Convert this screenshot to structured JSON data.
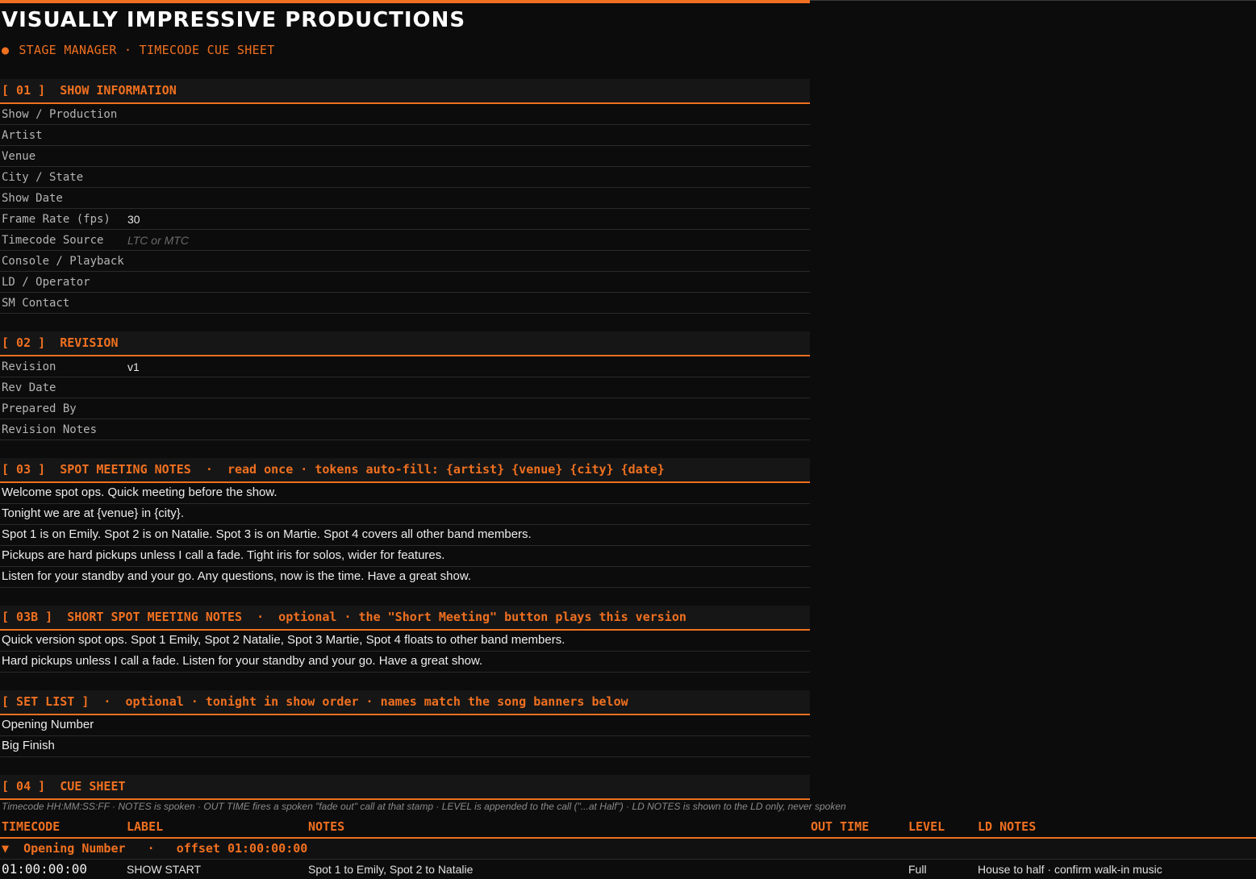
{
  "header": {
    "title": "VISUALLY IMPRESSIVE PRODUCTIONS",
    "subtitle_dot": "●",
    "subtitle": "STAGE MANAGER · TIMECODE CUE SHEET"
  },
  "show_info": {
    "header": "[ 01 ]  SHOW INFORMATION",
    "fields": [
      {
        "label": "Show / Production",
        "value": ""
      },
      {
        "label": "Artist",
        "value": ""
      },
      {
        "label": "Venue",
        "value": ""
      },
      {
        "label": "City / State",
        "value": ""
      },
      {
        "label": "Show Date",
        "value": ""
      },
      {
        "label": "Frame Rate (fps)",
        "value": "30"
      },
      {
        "label": "Timecode Source",
        "value": "",
        "placeholder": "LTC or MTC"
      },
      {
        "label": "Console / Playback",
        "value": ""
      },
      {
        "label": "LD / Operator",
        "value": ""
      },
      {
        "label": "SM Contact",
        "value": ""
      }
    ]
  },
  "revision": {
    "header": "[ 02 ]  REVISION",
    "fields": [
      {
        "label": "Revision",
        "value": "v1"
      },
      {
        "label": "Rev Date",
        "value": ""
      },
      {
        "label": "Prepared By",
        "value": ""
      },
      {
        "label": "Revision Notes",
        "value": ""
      }
    ]
  },
  "spot_notes": {
    "header": "[ 03 ]  SPOT MEETING NOTES  ·  read once · tokens auto-fill: {artist} {venue} {city} {date}",
    "lines": [
      "Welcome spot ops. Quick meeting before the show.",
      "Tonight we are at {venue} in {city}.",
      "Spot 1 is on Emily. Spot 2 is on Natalie. Spot 3 is on Martie. Spot 4 covers all other band members.",
      "Pickups are hard pickups unless I call a fade. Tight iris for solos, wider for features.",
      "Listen for your standby and your go. Any questions, now is the time. Have a great show."
    ]
  },
  "short_notes": {
    "header": "[ 03B ]  SHORT SPOT MEETING NOTES  ·  optional · the \"Short Meeting\" button plays this version",
    "lines": [
      "Quick version spot ops. Spot 1 Emily, Spot 2 Natalie, Spot 3 Martie, Spot 4 floats to other band members.",
      "Hard pickups unless I call a fade. Listen for your standby and your go. Have a great show."
    ]
  },
  "set_list": {
    "header": "[ SET LIST ]  ·  optional · tonight in show order · names match the song banners below",
    "songs": [
      "Opening Number",
      "Big Finish"
    ]
  },
  "cue_sheet": {
    "header": "[ 04 ]  CUE SHEET",
    "caption": "Timecode HH:MM:SS:FF · NOTES is spoken · OUT TIME fires a spoken \"fade out\" call at that stamp · LEVEL is appended to the call (\"...at Half\") · LD NOTES is shown to the LD only, never spoken",
    "columns": {
      "timecode": "TIMECODE",
      "label": "LABEL",
      "notes": "NOTES",
      "out_time": "OUT TIME",
      "level": "LEVEL",
      "ld_notes": "LD NOTES"
    },
    "group": "▼  Opening Number   ·   offset 01:00:00:00",
    "rows": [
      {
        "timecode": "01:00:00:00",
        "label": "SHOW START",
        "notes": "Spot 1 to Emily, Spot 2 to Natalie",
        "out_time": "",
        "level": "Full",
        "ld_notes": "House to half · confirm walk-in music"
      }
    ]
  }
}
